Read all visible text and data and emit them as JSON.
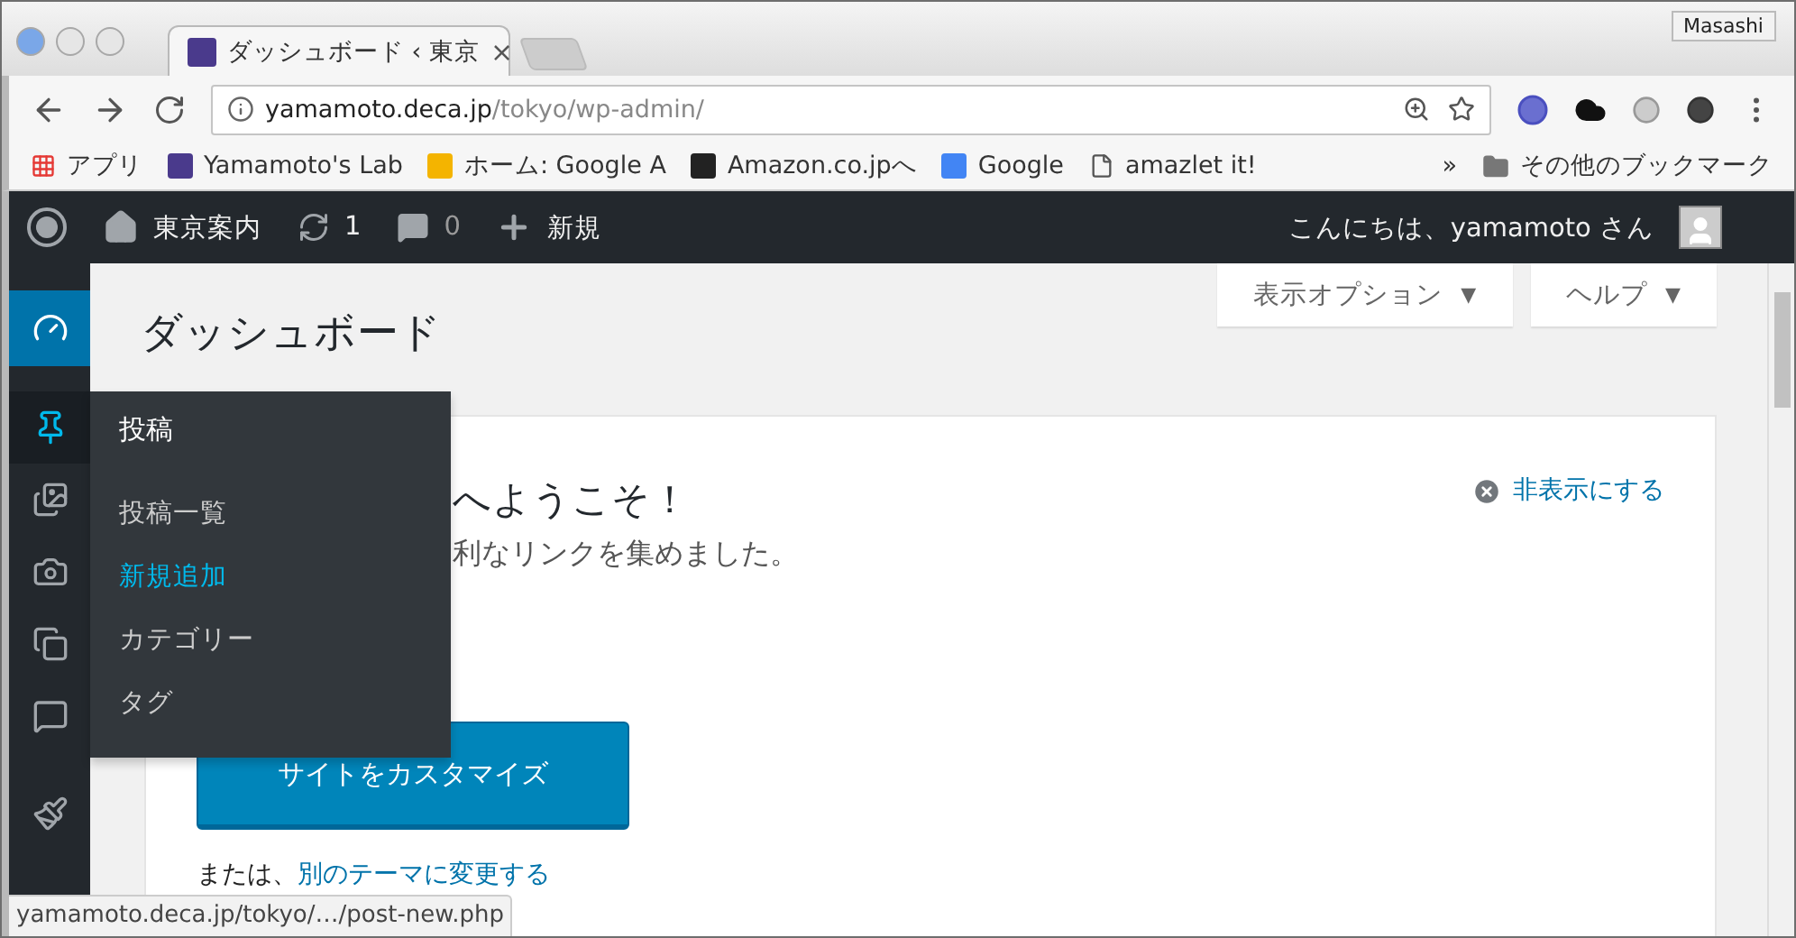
{
  "browser": {
    "profile": "Masashi",
    "tabs": [
      {
        "title": "ダッシュボード ‹ 東京",
        "close": "×",
        "selected": true
      }
    ],
    "address": {
      "host": "yamamoto.deca.jp",
      "path": "/tokyo/wp-admin/"
    },
    "bookmarks": [
      {
        "label": "アプリ"
      },
      {
        "label": "Yamamoto's Lab"
      },
      {
        "label": "ホーム: Google A"
      },
      {
        "label": "Amazon.co.jpへ"
      },
      {
        "label": "Google"
      },
      {
        "label": "amazlet it!"
      }
    ],
    "bookmarks_more": "»",
    "other_bookmarks": "その他のブックマーク",
    "status_url": "yamamoto.deca.jp/tokyo/…/post-new.php"
  },
  "admin_bar": {
    "site": "東京案内",
    "updates": "1",
    "comments": "0",
    "new": "新規",
    "greeting": "こんにちは、yamamoto さん"
  },
  "sidebar": {
    "items": [
      {
        "selected": true,
        "hovered": false
      },
      {
        "selected": false,
        "hovered": true
      },
      {
        "selected": false,
        "hovered": false
      },
      {
        "selected": false,
        "hovered": false
      },
      {
        "selected": false,
        "hovered": false
      },
      {
        "selected": false,
        "hovered": false
      },
      {
        "selected": false,
        "hovered": false
      }
    ]
  },
  "flyout": {
    "title": "投稿",
    "items": [
      {
        "label": "投稿一覧",
        "selected": false
      },
      {
        "label": "新規追加",
        "selected": true
      },
      {
        "label": "カテゴリー",
        "selected": false
      },
      {
        "label": "タグ",
        "selected": false
      }
    ]
  },
  "screen_meta": [
    {
      "label": "表示オプション",
      "caret": "▼"
    },
    {
      "label": "ヘルプ",
      "caret": "▼"
    }
  ],
  "page_title": "ダッシュボード",
  "welcome": {
    "heading": "へようこそ！",
    "text": "利なリンクを集めました。",
    "dismiss": "非表示にする",
    "button": "サイトをカスタマイズ",
    "alt_prefix": "または、",
    "alt_link": "別のテーマに変更する"
  }
}
